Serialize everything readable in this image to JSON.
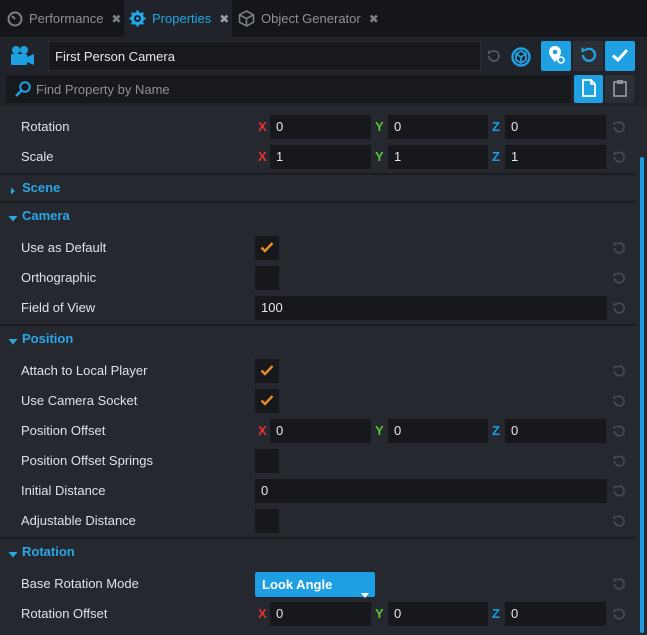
{
  "tabs": [
    {
      "label": "Performance",
      "icon": "gauge-icon",
      "active": false
    },
    {
      "label": "Properties",
      "icon": "gear-icon",
      "active": true
    },
    {
      "label": "Object Generator",
      "icon": "cube-icon",
      "active": false
    }
  ],
  "header": {
    "object_name": "First Person Camera",
    "search_placeholder": "Find Property by Name"
  },
  "transform": {
    "rotation": {
      "label": "Rotation",
      "x": "0",
      "y": "0",
      "z": "0"
    },
    "scale": {
      "label": "Scale",
      "x": "1",
      "y": "1",
      "z": "1"
    }
  },
  "axes": {
    "x": "X",
    "y": "Y",
    "z": "Z"
  },
  "sections": {
    "scene": "Scene",
    "camera": "Camera",
    "position": "Position",
    "rotation": "Rotation"
  },
  "camera": {
    "use_as_default": {
      "label": "Use as Default",
      "checked": true
    },
    "orthographic": {
      "label": "Orthographic",
      "checked": false
    },
    "field_of_view": {
      "label": "Field of View",
      "value": "100"
    }
  },
  "position": {
    "attach_to_local_player": {
      "label": "Attach to Local Player",
      "checked": true
    },
    "use_camera_socket": {
      "label": "Use Camera Socket",
      "checked": true
    },
    "position_offset": {
      "label": "Position Offset",
      "x": "0",
      "y": "0",
      "z": "0"
    },
    "position_offset_springs": {
      "label": "Position Offset Springs",
      "checked": false
    },
    "initial_distance": {
      "label": "Initial Distance",
      "value": "0"
    },
    "adjustable_distance": {
      "label": "Adjustable Distance",
      "checked": false
    }
  },
  "rotation": {
    "base_rotation_mode": {
      "label": "Base Rotation Mode",
      "value": "Look Angle"
    },
    "rotation_offset": {
      "label": "Rotation Offset",
      "x": "0",
      "y": "0",
      "z": "0"
    }
  },
  "colors": {
    "accent": "#1ea0e3",
    "check": "#e8892a",
    "axis_x": "#e5322d",
    "axis_y": "#58c23a",
    "axis_z": "#1e9ee6"
  }
}
